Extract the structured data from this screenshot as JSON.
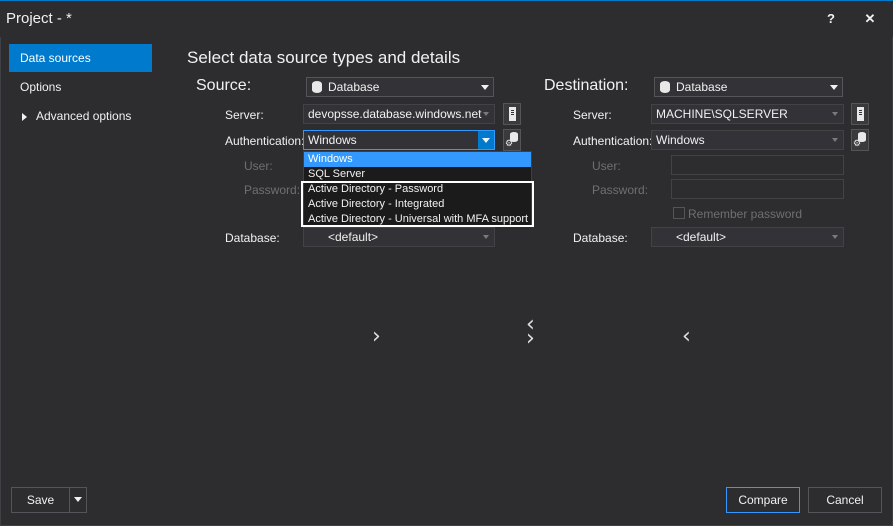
{
  "window": {
    "title": "Project - *",
    "help_label": "?",
    "close_label": "✕"
  },
  "sidebar": {
    "items": [
      {
        "label": "Data sources",
        "active": true
      },
      {
        "label": "Options",
        "active": false
      },
      {
        "label": "Advanced options",
        "active": false,
        "expandable": true
      }
    ]
  },
  "main": {
    "heading": "Select data source types and details",
    "source": {
      "title": "Source:",
      "type_value": "Database",
      "server_label": "Server:",
      "server_value": "devopsse.database.windows.net",
      "auth_label": "Authentication:",
      "auth_value": "Windows",
      "user_label": "User:",
      "password_label": "Password:",
      "database_label": "Database:",
      "database_value": "<default>",
      "auth_options": [
        "Windows",
        "SQL Server",
        "Active Directory - Password",
        "Active Directory - Integrated",
        "Active Directory - Universal with MFA support"
      ],
      "selected_option": "Windows"
    },
    "destination": {
      "title": "Destination:",
      "type_value": "Database",
      "server_label": "Server:",
      "server_value": "MACHINE\\SQLSERVER",
      "auth_label": "Authentication:",
      "auth_value": "Windows",
      "user_label": "User:",
      "password_label": "Password:",
      "remember_label": "Remember password",
      "database_label": "Database:",
      "database_value": "<default>"
    },
    "chevrons": {
      "right": "›",
      "left": "‹"
    }
  },
  "footer": {
    "save_label": "Save",
    "compare_label": "Compare",
    "cancel_label": "Cancel"
  },
  "colors": {
    "accent": "#007acc",
    "background": "#2d2d30",
    "selection": "#3399ff"
  }
}
